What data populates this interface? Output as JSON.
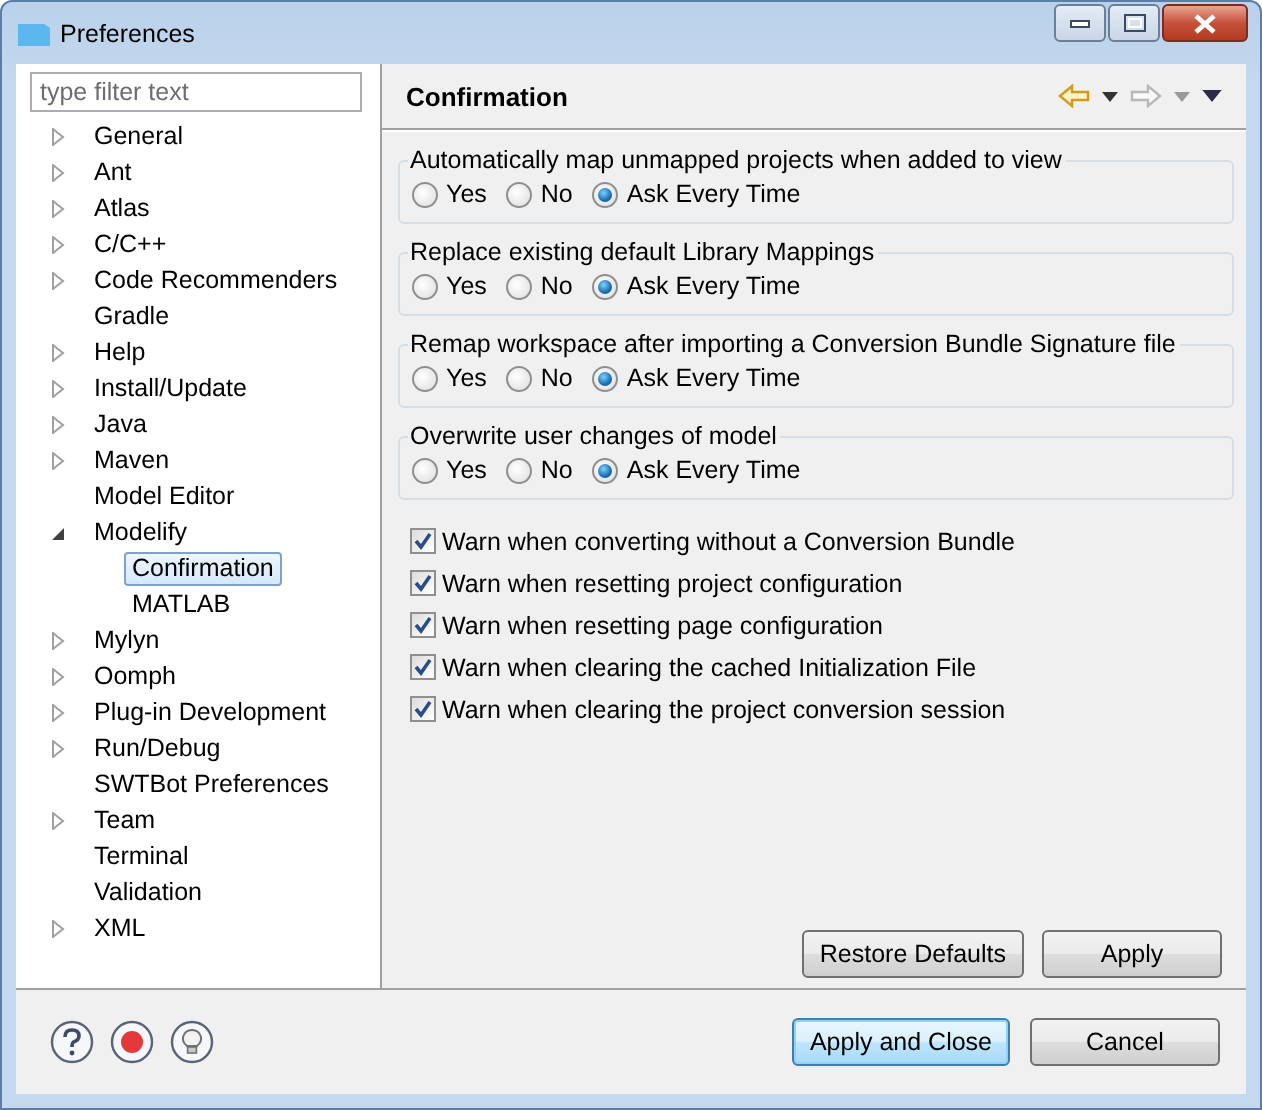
{
  "window": {
    "title": "Preferences"
  },
  "filter": {
    "placeholder": "type filter text"
  },
  "tree": [
    {
      "label": "General",
      "kind": "folder",
      "expanded": false,
      "selected": false
    },
    {
      "label": "Ant",
      "kind": "folder",
      "expanded": false,
      "selected": false
    },
    {
      "label": "Atlas",
      "kind": "folder",
      "expanded": false,
      "selected": false
    },
    {
      "label": "C/C++",
      "kind": "folder",
      "expanded": false,
      "selected": false
    },
    {
      "label": "Code Recommenders",
      "kind": "folder",
      "expanded": false,
      "selected": false
    },
    {
      "label": "Gradle",
      "kind": "leaf",
      "selected": false
    },
    {
      "label": "Help",
      "kind": "folder",
      "expanded": false,
      "selected": false
    },
    {
      "label": "Install/Update",
      "kind": "folder",
      "expanded": false,
      "selected": false
    },
    {
      "label": "Java",
      "kind": "folder",
      "expanded": false,
      "selected": false
    },
    {
      "label": "Maven",
      "kind": "folder",
      "expanded": false,
      "selected": false
    },
    {
      "label": "Model Editor",
      "kind": "leaf",
      "selected": false
    },
    {
      "label": "Modelify",
      "kind": "folder",
      "expanded": true,
      "selected": false,
      "children": [
        {
          "label": "Confirmation",
          "kind": "leaf",
          "selected": true
        },
        {
          "label": "MATLAB",
          "kind": "leaf",
          "selected": false
        }
      ]
    },
    {
      "label": "Mylyn",
      "kind": "folder",
      "expanded": false,
      "selected": false
    },
    {
      "label": "Oomph",
      "kind": "folder",
      "expanded": false,
      "selected": false
    },
    {
      "label": "Plug-in Development",
      "kind": "folder",
      "expanded": false,
      "selected": false
    },
    {
      "label": "Run/Debug",
      "kind": "folder",
      "expanded": false,
      "selected": false
    },
    {
      "label": "SWTBot Preferences",
      "kind": "leaf",
      "selected": false
    },
    {
      "label": "Team",
      "kind": "folder",
      "expanded": false,
      "selected": false
    },
    {
      "label": "Terminal",
      "kind": "leaf",
      "selected": false
    },
    {
      "label": "Validation",
      "kind": "leaf",
      "selected": false
    },
    {
      "label": "XML",
      "kind": "folder",
      "expanded": false,
      "selected": false
    }
  ],
  "page": {
    "title": "Confirmation",
    "groups": [
      {
        "title": "Automatically map unmapped projects when added to view",
        "options": [
          {
            "label": "Yes",
            "selected": false
          },
          {
            "label": "No",
            "selected": false
          },
          {
            "label": "Ask Every Time",
            "selected": true
          }
        ]
      },
      {
        "title": "Replace existing default Library Mappings",
        "options": [
          {
            "label": "Yes",
            "selected": false
          },
          {
            "label": "No",
            "selected": false
          },
          {
            "label": "Ask Every Time",
            "selected": true
          }
        ]
      },
      {
        "title": "Remap workspace after importing a Conversion Bundle Signature file",
        "options": [
          {
            "label": "Yes",
            "selected": false
          },
          {
            "label": "No",
            "selected": false
          },
          {
            "label": "Ask Every Time",
            "selected": true
          }
        ]
      },
      {
        "title": "Overwrite user changes of model",
        "options": [
          {
            "label": "Yes",
            "selected": false
          },
          {
            "label": "No",
            "selected": false
          },
          {
            "label": "Ask Every Time",
            "selected": true
          }
        ]
      }
    ],
    "checkboxes": [
      {
        "label": "Warn when converting without a Conversion Bundle",
        "checked": true
      },
      {
        "label": "Warn when resetting project configuration",
        "checked": true
      },
      {
        "label": "Warn when resetting page configuration",
        "checked": true
      },
      {
        "label": "Warn when clearing the cached Initialization File",
        "checked": true
      },
      {
        "label": "Warn when clearing the project conversion session",
        "checked": true
      }
    ],
    "buttons": [
      "Restore Defaults",
      "Apply"
    ]
  },
  "footer": {
    "buttons": [
      {
        "label": "Apply and Close",
        "default": true
      },
      {
        "label": "Cancel",
        "default": false
      }
    ]
  }
}
